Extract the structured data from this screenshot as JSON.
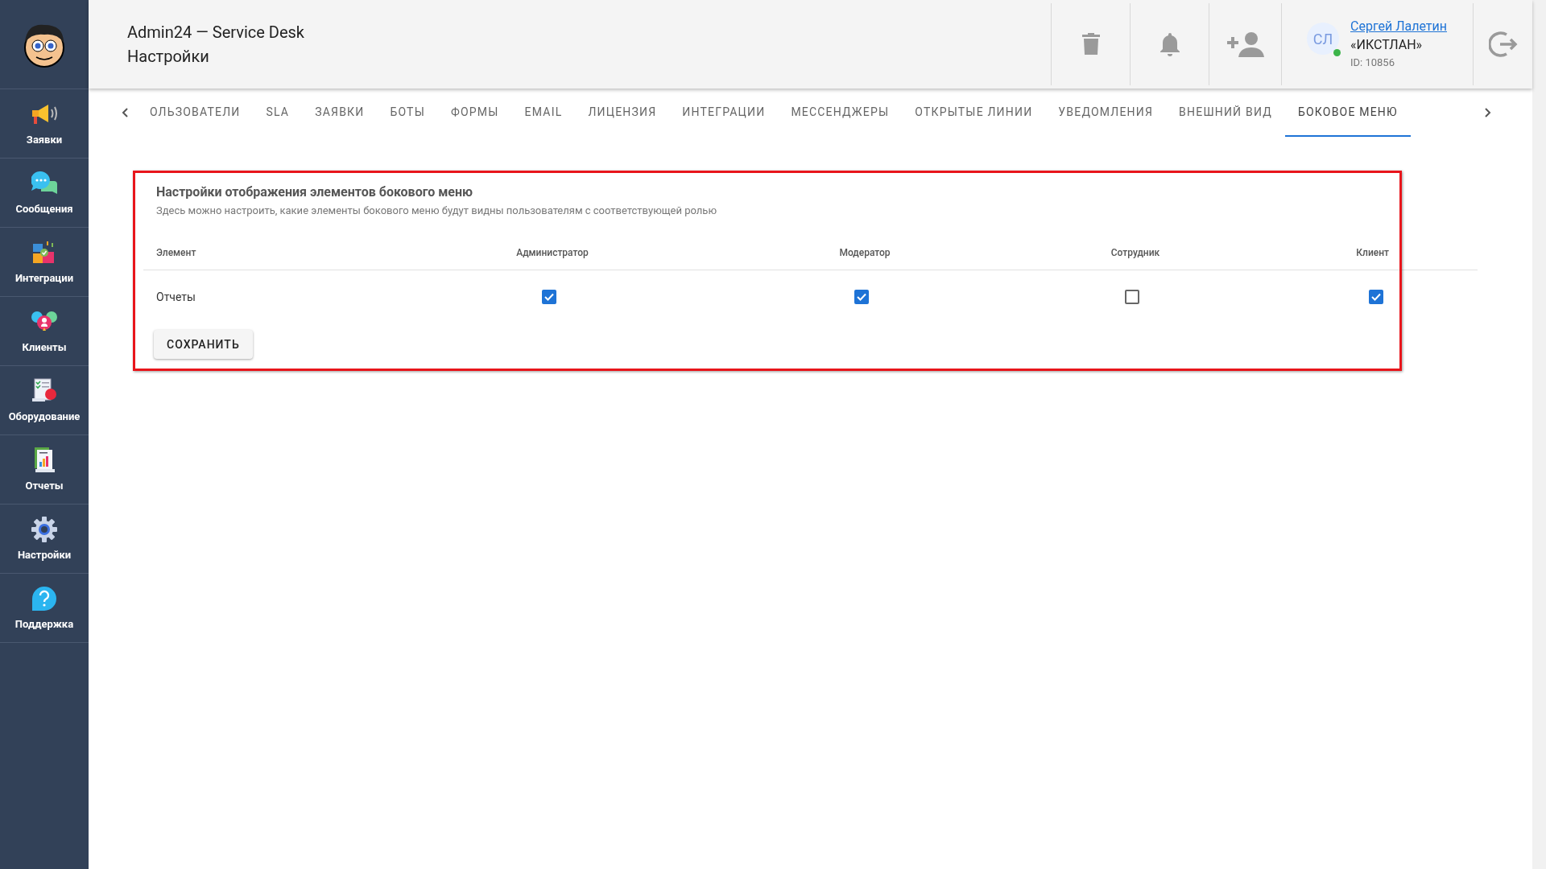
{
  "sidebar": {
    "items": [
      {
        "label": "Заявки",
        "kind": "megaphone"
      },
      {
        "label": "Сообщения",
        "kind": "chat"
      },
      {
        "label": "Интеграции",
        "kind": "puzzle"
      },
      {
        "label": "Клиенты",
        "kind": "people"
      },
      {
        "label": "Оборудование",
        "kind": "checklist"
      },
      {
        "label": "Отчеты",
        "kind": "report"
      },
      {
        "label": "Настройки",
        "kind": "gear"
      },
      {
        "label": "Поддержка",
        "kind": "help"
      }
    ]
  },
  "header": {
    "app_title": "Admin24 — Service Desk",
    "page_title": "Настройки",
    "user": {
      "initials": "СЛ",
      "online": true,
      "name": "Сергей Лалетин",
      "company": "«ИКСТЛАН»",
      "id": "ID: 10856"
    }
  },
  "tabs": [
    {
      "label": "ОЛЬЗОВАТЕЛИ",
      "selected": false
    },
    {
      "label": "SLA",
      "selected": false
    },
    {
      "label": "ЗАЯВКИ",
      "selected": false
    },
    {
      "label": "БОТЫ",
      "selected": false
    },
    {
      "label": "ФОРМЫ",
      "selected": false
    },
    {
      "label": "EMAIL",
      "selected": false
    },
    {
      "label": "ЛИЦЕНЗИЯ",
      "selected": false
    },
    {
      "label": "ИНТЕГРАЦИИ",
      "selected": false
    },
    {
      "label": "МЕССЕНДЖЕРЫ",
      "selected": false
    },
    {
      "label": "ОТКРЫТЫЕ ЛИНИИ",
      "selected": false
    },
    {
      "label": "УВЕДОМЛЕНИЯ",
      "selected": false
    },
    {
      "label": "ВНЕШНИЙ ВИД",
      "selected": false
    },
    {
      "label": "БОКОВОЕ МЕНЮ",
      "selected": true
    }
  ],
  "panel": {
    "title": "Настройки отображения элементов бокового меню",
    "description": "Здесь можно настроить, какие элементы бокового меню будут видны пользователям с соответствующей ролью",
    "table": {
      "columns": [
        "Элемент",
        "Администратор",
        "Модератор",
        "Сотрудник",
        "Клиент"
      ],
      "rows": [
        {
          "element": "Отчеты",
          "roles": [
            {
              "checked": true
            },
            {
              "checked": true
            },
            {
              "checked": false
            },
            {
              "checked": true
            }
          ]
        }
      ]
    },
    "save_button": "СОХРАНИТЬ"
  }
}
